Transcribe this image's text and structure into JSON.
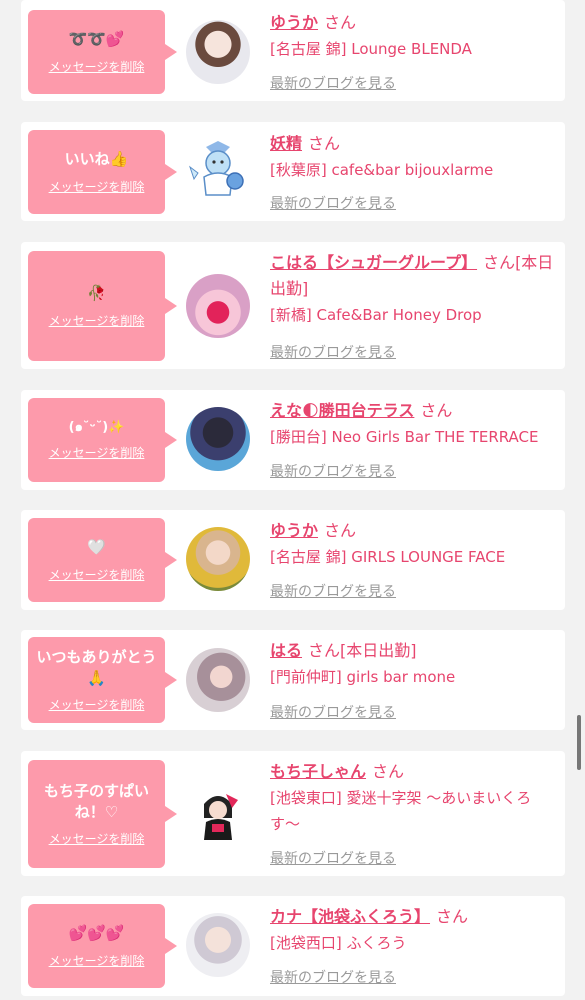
{
  "delete_label": "メッセージを削除",
  "blog_label": "最新のブログを見る",
  "san_label": "さん",
  "cards": [
    {
      "message": "➰➰💕",
      "name": "ゆうか",
      "suffix": "",
      "shop": "[名古屋 錦] Lounge BLENDA"
    },
    {
      "message": "いいね👍",
      "name": "妖精",
      "suffix": "",
      "shop": "[秋葉原] cafe&bar bijouxlarme"
    },
    {
      "message": "🥀",
      "name": "こはる【シュガーグループ】",
      "suffix": "[本日出勤]",
      "shop": "[新橋] Cafe&Bar Honey Drop"
    },
    {
      "message": "(๑˘ᵕ˘)✨",
      "name": "えな🌓勝田台テラス",
      "suffix": "",
      "shop": "[勝田台] Neo Girls Bar THE TERRACE"
    },
    {
      "message": "🤍",
      "name": "ゆうか",
      "suffix": "",
      "shop": "[名古屋 錦] GIRLS LOUNGE FACE"
    },
    {
      "message": "いつもありがとう🙏",
      "name": "はる",
      "suffix": "[本日出勤]",
      "shop": "[門前仲町] girls bar mone"
    },
    {
      "message": "もち子のすぱいね！♡",
      "name": "もち子しゃん",
      "suffix": "",
      "shop": "[池袋東口] 愛迷十字架 〜あいまいくろす〜"
    },
    {
      "message": "💕💕💕",
      "name": "カナ【池袋ふくろう】",
      "suffix": "",
      "shop": "[池袋西口] ふくろう"
    }
  ]
}
